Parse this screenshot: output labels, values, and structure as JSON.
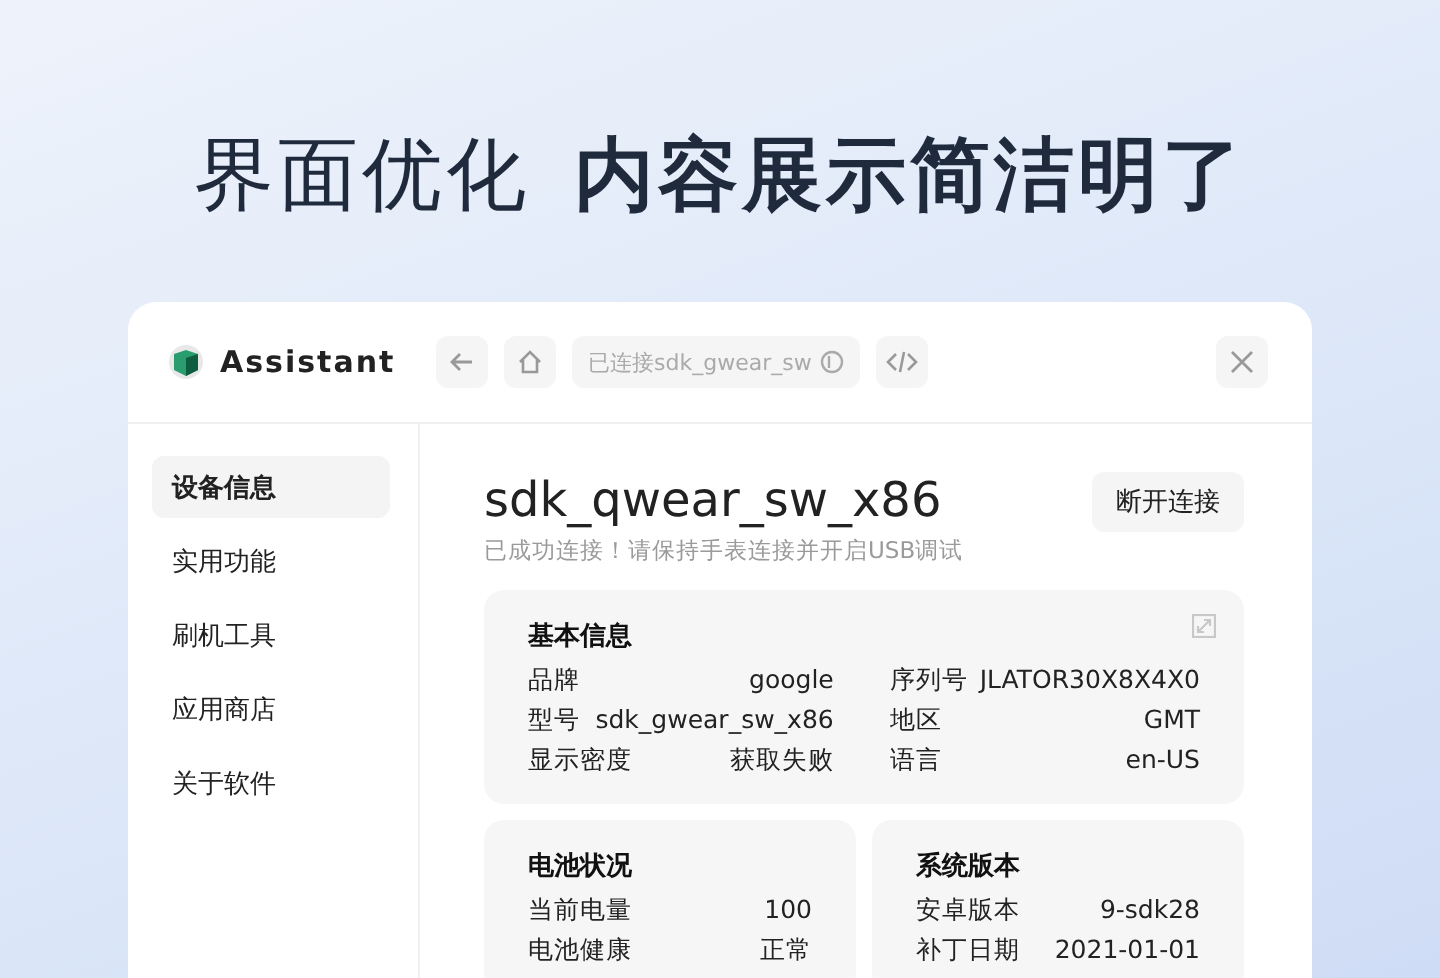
{
  "headline": {
    "lead": "界面优化",
    "emphasis": "内容展示简洁明了"
  },
  "app": {
    "name": "Assistant",
    "address": "已连接sdk_gwear_sw"
  },
  "sidebar": {
    "items": [
      {
        "label": "设备信息",
        "selected": true
      },
      {
        "label": "实用功能",
        "selected": false
      },
      {
        "label": "刷机工具",
        "selected": false
      },
      {
        "label": "应用商店",
        "selected": false
      },
      {
        "label": "关于软件",
        "selected": false
      }
    ]
  },
  "device": {
    "title": "sdk_qwear_sw_x86",
    "subtitle": "已成功连接！请保持手表连接并开启USB调试",
    "action": "断开连接"
  },
  "cards": [
    {
      "title": "基本信息",
      "wide": true,
      "columns": [
        [
          {
            "label": "品牌",
            "value": "google"
          },
          {
            "label": "型号",
            "value": "sdk_gwear_sw_x86"
          },
          {
            "label": "显示密度",
            "value": "获取失败"
          }
        ],
        [
          {
            "label": "序列号",
            "value": "JLATOR30X8X4X0"
          },
          {
            "label": "地区",
            "value": "GMT"
          },
          {
            "label": "语言",
            "value": "en-US"
          }
        ]
      ]
    },
    {
      "title": "电池状况",
      "wide": false,
      "columns": [
        [
          {
            "label": "当前电量",
            "value": "100"
          },
          {
            "label": "电池健康",
            "value": "正常"
          }
        ]
      ]
    },
    {
      "title": "系统版本",
      "wide": false,
      "columns": [
        [
          {
            "label": "安卓版本",
            "value": "9-sdk28"
          },
          {
            "label": "补丁日期",
            "value": "2021-01-01"
          }
        ]
      ]
    }
  ]
}
